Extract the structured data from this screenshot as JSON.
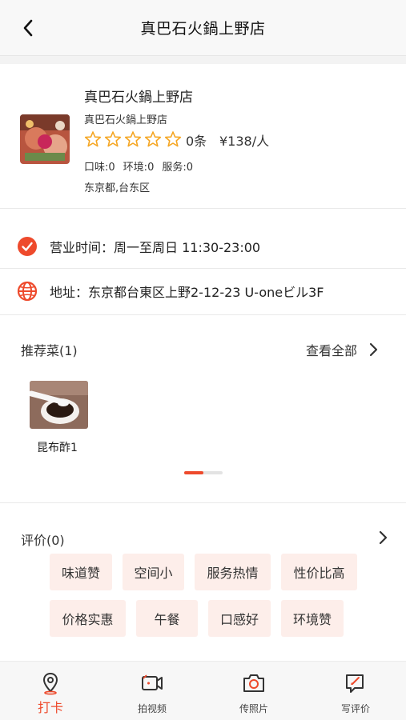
{
  "header": {
    "title": "真巴石火鍋上野店"
  },
  "store": {
    "name": "真巴石火鍋上野店",
    "subname": "真巴石火鍋上野店",
    "rating_stars": 0,
    "rating_max": 5,
    "review_count": "0条",
    "price": "¥138/人",
    "scores": [
      {
        "label": "口味:",
        "value": "0"
      },
      {
        "label": "环境:",
        "value": "0"
      },
      {
        "label": "服务:",
        "value": "0"
      }
    ],
    "location": "东京都,台东区"
  },
  "info": {
    "hours": "营业时间：周一至周日 11:30-23:00",
    "address": "地址：东京都台東区上野2-12-23 U-oneビル3F"
  },
  "recommend": {
    "title": "推荐菜(1)",
    "view_all": "查看全部",
    "dishes": [
      {
        "name": "昆布酢1"
      }
    ],
    "page_progress": 0.5
  },
  "reviews": {
    "title": "评价(0)",
    "tags": [
      "味道赞",
      "空间小",
      "服务热情",
      "性价比高",
      "价格实惠",
      "午餐",
      "口感好",
      "环境赞"
    ]
  },
  "tabbar": {
    "items": [
      {
        "label": "打卡",
        "icon": "location-pin-icon",
        "active": true
      },
      {
        "label": "拍视频",
        "icon": "video-camera-icon",
        "active": false
      },
      {
        "label": "传照片",
        "icon": "photo-camera-icon",
        "active": false
      },
      {
        "label": "写评价",
        "icon": "write-review-icon",
        "active": false
      }
    ]
  },
  "colors": {
    "accent": "#ee4a2c",
    "star": "#f5a623",
    "tag_bg": "#fdeeea"
  }
}
